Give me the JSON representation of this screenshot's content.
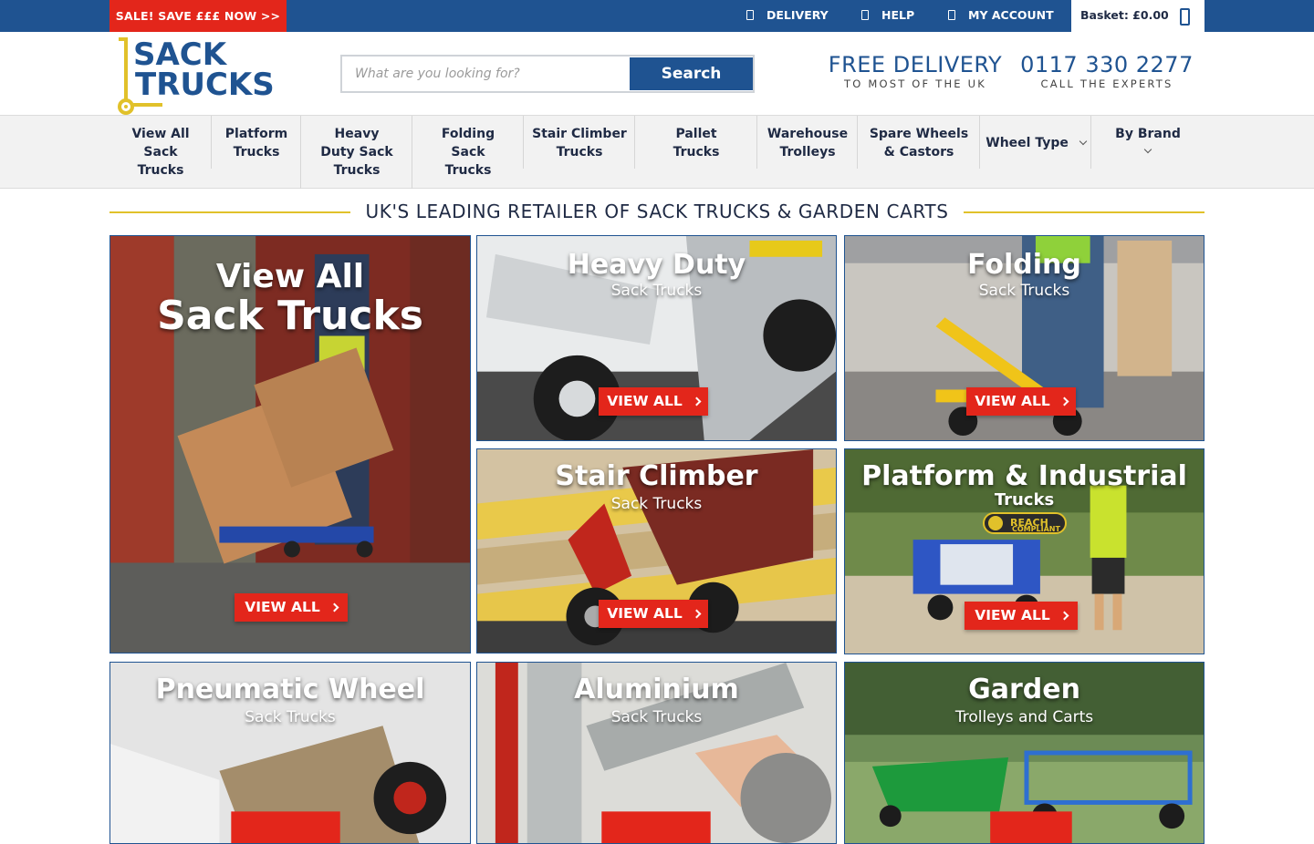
{
  "topbar": {
    "sale_label": "SALE! SAVE £££ NOW >>",
    "links": [
      {
        "label": "DELIVERY",
        "icon": "truck-icon"
      },
      {
        "label": "HELP",
        "icon": "help-icon"
      },
      {
        "label": "MY ACCOUNT",
        "icon": "user-icon"
      }
    ],
    "basket_label": "Basket: £0.00",
    "basket_icon": "basket-icon"
  },
  "header": {
    "logo_line1": "SACK",
    "logo_line2": "TRUCKS",
    "search_placeholder": "What are you looking for?",
    "search_button": "Search",
    "delivery_title": "FREE DELIVERY",
    "delivery_sub": "TO MOST OF THE UK",
    "phone_title": "0117 330 2277",
    "phone_sub": "CALL THE EXPERTS"
  },
  "nav": {
    "items": [
      {
        "label_lines": [
          "View All",
          "Sack",
          "Trucks"
        ]
      },
      {
        "label_lines": [
          "Platform",
          "Trucks"
        ]
      },
      {
        "label_lines": [
          "Heavy",
          "Duty Sack",
          "Trucks"
        ]
      },
      {
        "label_lines": [
          "Folding",
          "Sack",
          "Trucks"
        ]
      },
      {
        "label_lines": [
          "Stair Climber",
          "Trucks"
        ]
      },
      {
        "label_lines": [
          "Pallet",
          "Trucks"
        ]
      },
      {
        "label_lines": [
          "Warehouse",
          "Trolleys"
        ]
      },
      {
        "label_lines": [
          "Spare Wheels",
          "& Castors"
        ]
      },
      {
        "label_lines": [
          "Wheel Type"
        ],
        "dropdown": true
      },
      {
        "label_lines": [
          "By Brand"
        ],
        "dropdown": true
      }
    ]
  },
  "main": {
    "heading": "UK'S LEADING RETAILER OF SACK TRUCKS & GARDEN CARTS",
    "tiles": [
      {
        "title1": "View All",
        "title2": "Sack Trucks",
        "button": "VIEW ALL"
      },
      {
        "title1": "Heavy Duty",
        "sub": "Sack Trucks",
        "button": "VIEW ALL"
      },
      {
        "title1": "Folding",
        "sub": "Sack Trucks",
        "button": "VIEW ALL"
      },
      {
        "title1": "Stair Climber",
        "sub": "Sack Trucks",
        "button": "VIEW ALL"
      },
      {
        "title1": "Platform & Industrial",
        "sub": "Trucks",
        "badge": "REACH",
        "badge_sub": "COMPLIANT",
        "button": "VIEW ALL"
      },
      {
        "title1": "Pneumatic Wheel",
        "sub": "Sack Trucks"
      },
      {
        "title1": "Aluminium",
        "sub": "Sack Trucks"
      },
      {
        "title1": "Garden",
        "sub": "Trolleys and Carts"
      }
    ]
  },
  "colors": {
    "brand_blue": "#1f5391",
    "sale_red": "#e3261b",
    "accent_yellow": "#e1c12a"
  }
}
